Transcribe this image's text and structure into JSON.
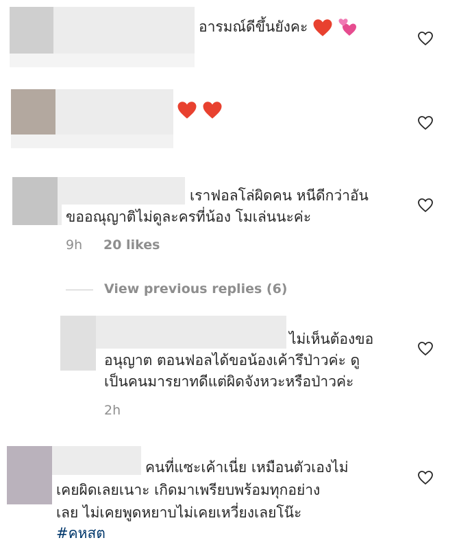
{
  "comments": [
    {
      "text": "อารมณ์ดีขึ้นยังคะ",
      "emojis": [
        "red-heart",
        "two-hearts"
      ]
    },
    {
      "text": "",
      "emojis": [
        "red-heart",
        "red-heart"
      ]
    },
    {
      "lines": [
        "เราฟอลโล่ผิดคน หนีดีกว่าอัน",
        "ขออณุญาติไม่ดูละครที่น้อง โมเล่นนะค่ะ"
      ],
      "time": "9h",
      "likes": "20 likes"
    },
    {
      "lines": [
        "ไม่เห็นต้องขอ",
        "อนุญาต ตอนฟอลได้ขอน้องเค้ารึป่าวค่ะ ดู",
        "เป็นคนมารยาทดีแต่ผิดจังหวะหรือป่าวค่ะ"
      ],
      "time": "2h"
    },
    {
      "lines": [
        "คนที่แซะเค้าเนี่ย เหมือนตัวเองไม่",
        "เคยผิดเลยเนาะ เกิดมาเพรียบพร้อมทุกอย่าง",
        "เลย ไม่เคยพูดหยาบไม่เคยเหวี่ยงเลยโน๊ะ"
      ],
      "hashtag": "#คหสต"
    }
  ],
  "view_replies": "View previous replies (6)",
  "colors": {
    "heart_red": "#e8412f",
    "text": "#262626",
    "meta": "#8e8e8e",
    "link": "#00376b"
  },
  "icons": [
    "heart-outline-icon"
  ]
}
